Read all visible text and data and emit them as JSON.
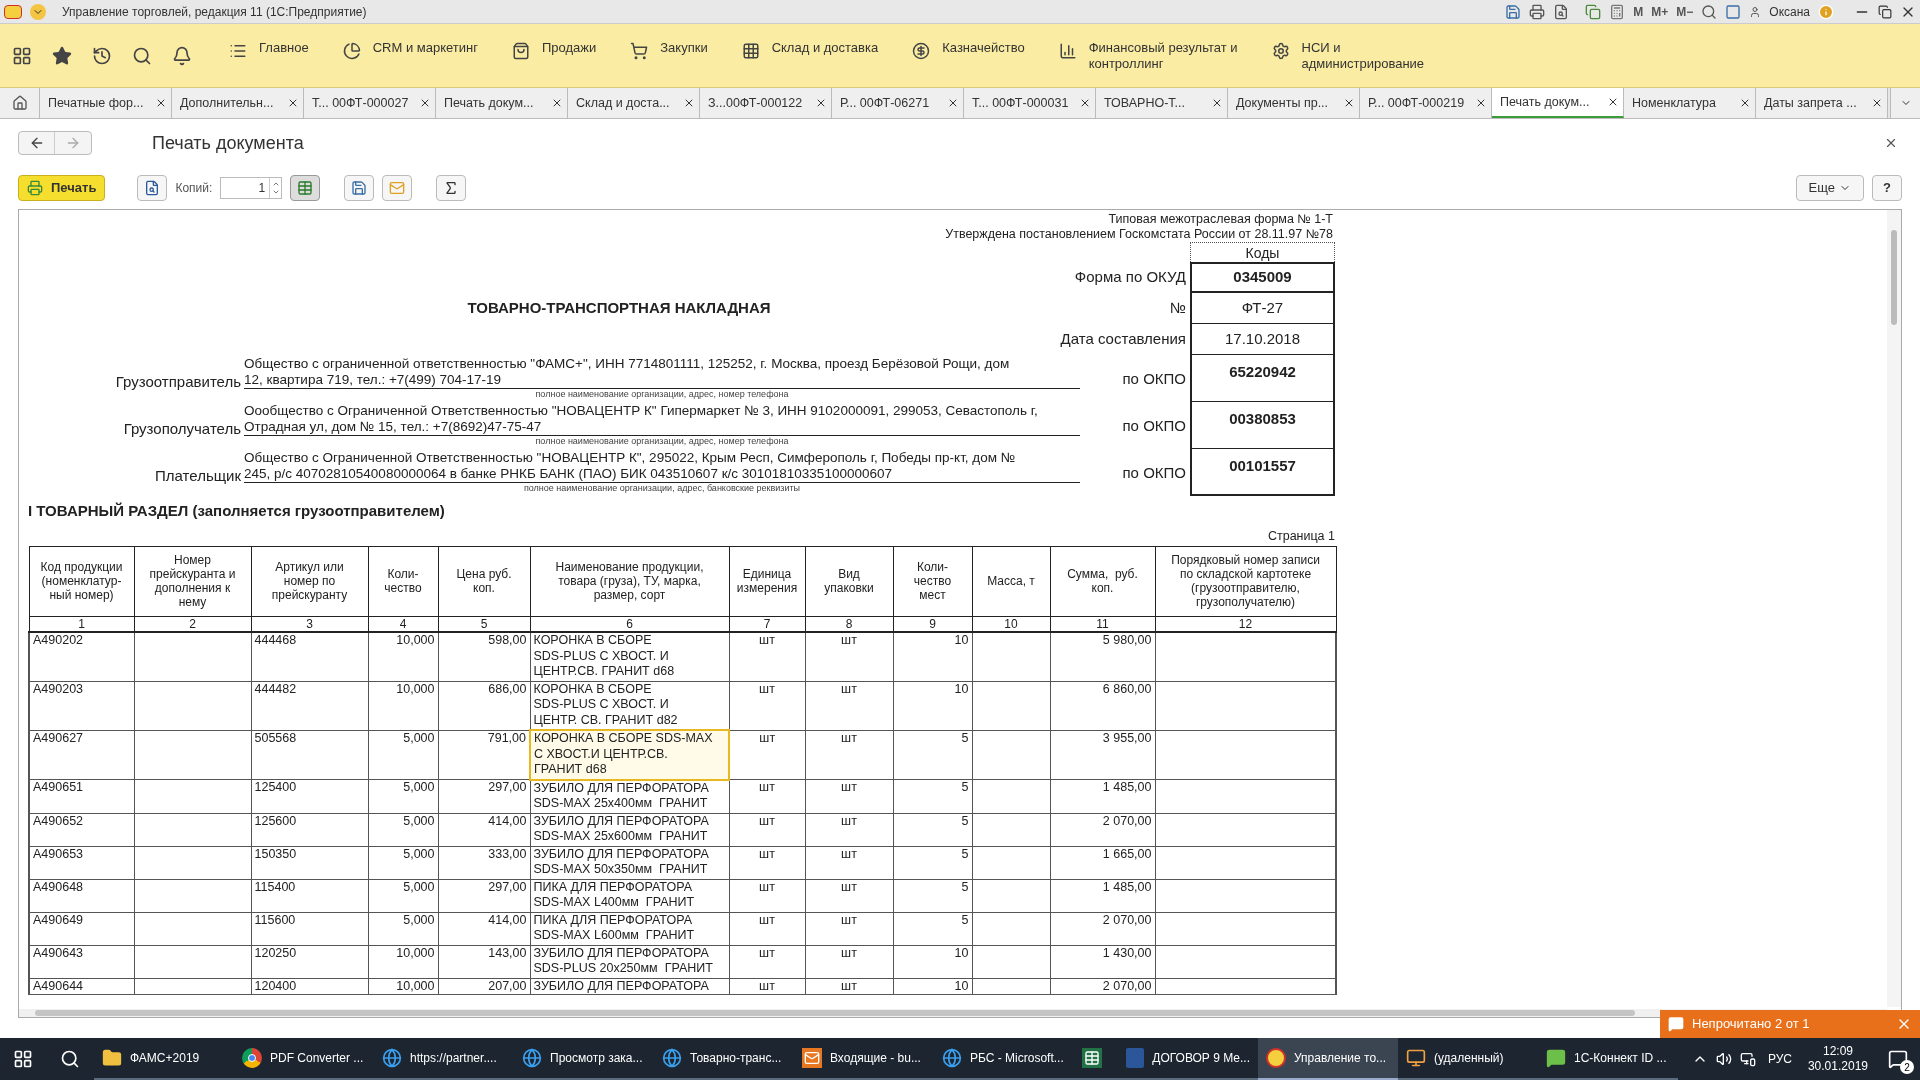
{
  "window": {
    "title": "Управление торговлей, редакция 11 (1С:Предприятие)",
    "memory_buttons": [
      "M",
      "M+",
      "M−"
    ],
    "user": "Оксана"
  },
  "menu": {
    "sections": [
      {
        "kind": "list",
        "label": "Главное"
      },
      {
        "kind": "pie",
        "label": "CRM и маркетинг"
      },
      {
        "kind": "bag",
        "label": "Продажи"
      },
      {
        "kind": "cart",
        "label": "Закупки"
      },
      {
        "kind": "grid",
        "label": "Склад и доставка"
      },
      {
        "kind": "coin",
        "label": "Казначейство"
      },
      {
        "kind": "chart",
        "label": "Финансовый результат и\nконтроллинг"
      },
      {
        "kind": "gear",
        "label": "НСИ и\nадминистрирование"
      }
    ]
  },
  "tabs": [
    {
      "label": "Печатные фор...",
      "selected": false
    },
    {
      "label": "Дополнительн...",
      "selected": false
    },
    {
      "label": "Т... 00ФТ-000027",
      "selected": false
    },
    {
      "label": "Печать докум...",
      "selected": false
    },
    {
      "label": "Склад и доста...",
      "selected": false
    },
    {
      "label": "З...00ФТ-000122",
      "selected": false
    },
    {
      "label": "Р... 00ФТ-06271",
      "selected": false
    },
    {
      "label": "Т... 00ФТ-000031",
      "selected": false
    },
    {
      "label": "ТОВАРНО-Т...",
      "selected": false
    },
    {
      "label": "Документы пр...",
      "selected": false
    },
    {
      "label": "Р... 00ФТ-000219",
      "selected": false
    },
    {
      "label": "Печать докум...",
      "selected": true
    },
    {
      "label": "Номенклатура",
      "selected": false
    },
    {
      "label": "Даты запрета ...",
      "selected": false
    }
  ],
  "form": {
    "title": "Печать документа",
    "print_button": "Печать",
    "copies_label": "Копий:",
    "copies_value": "1",
    "more_button": "Еще",
    "help_button": "?"
  },
  "document": {
    "form_note": [
      "Типовая межотраслевая форма № 1-Т",
      "Утверждена постановлением Госкомстата России от 28.11.97 №78"
    ],
    "codes_header": "Коды",
    "title": "ТОВАРНО-ТРАНСПОРТНАЯ НАКЛАДНАЯ",
    "codes": [
      {
        "label": "Форма по ОКУД",
        "value": "0345009",
        "bold": true
      },
      {
        "label": "№",
        "value": "ФТ-27",
        "bold": false
      },
      {
        "label": "Дата составления",
        "value": "17.10.2018",
        "bold": false
      }
    ],
    "parties": [
      {
        "label": "Грузоотправитель",
        "text": "Общество с ограниченной ответственностью \"ФАМС+\", ИНН 7714801111, 125252, г. Москва, проезд Берёзовой Рощи, дом\n12, квартира 719, тел.: +7(499) 704-17-19",
        "caption": "полное наименование организации, адрес, номер телефона",
        "code_label": "по ОКПО",
        "code": "65220942"
      },
      {
        "label": "Грузополучатель",
        "text": "Оообщество с Ограниченной Ответственностью \"НОВАЦЕНТР К\" Гипермаркет № 3, ИНН 9102000091, 299053, Севастополь г,\nОтрадная ул, дом № 15, тел.: +7(8692)47-75-47",
        "caption": "полное наименование организации, адрес, номер телефона",
        "code_label": "по ОКПО",
        "code": "00380853"
      },
      {
        "label": "Плательщик",
        "text": "Общество с Ограниченной Ответственностью \"НОВАЦЕНТР К\", 295022, Крым Респ, Симферополь г, Победы пр-кт, дом №\n245, р/с 40702810540080000064 в банке РНКБ БАНК (ПАО) БИК 043510607 к/с 30101810335100000607",
        "caption": "полное наименование организации, адрес, банковские реквизиты",
        "code_label": "по ОКПО",
        "code": "00101557"
      }
    ],
    "section_title": "I ТОВАРНЫЙ РАЗДЕЛ (заполняется грузоотправителем)",
    "page_label": "Страница 1",
    "table": {
      "columns": [
        {
          "label": "Код продукции\n(номенклатур-\nный номер)",
          "number": "1"
        },
        {
          "label": "Номер\nпрейскуранта и\nдополнения к\nнему",
          "number": "2"
        },
        {
          "label": "Артикул или\nномер по\nпрейскуранту",
          "number": "3"
        },
        {
          "label": "Коли-\nчество",
          "number": "4"
        },
        {
          "label": "Цена руб.\nкоп.",
          "number": "5"
        },
        {
          "label": "Наименование продукции,\nтовара (груза), ТУ, марка,\nразмер, сорт",
          "number": "6"
        },
        {
          "label": "Единица\nизмерения",
          "number": "7"
        },
        {
          "label": "Вид\nупаковки",
          "number": "8"
        },
        {
          "label": "Коли-\nчество\nмест",
          "number": "9"
        },
        {
          "label": "Масса, т",
          "number": "10"
        },
        {
          "label": "Сумма,  руб.\nкоп.",
          "number": "11"
        },
        {
          "label": "Порядковый номер записи\nпо складской картотеке\n(грузоотправителю,\nгрузополучателю)",
          "number": "12"
        }
      ],
      "rows": [
        {
          "selected": false,
          "cells": [
            "A490202",
            "",
            "444468",
            "10,000",
            "598,00",
            "КОРОНКА В СБОРЕ\nSDS-PLUS С ХВОСТ. И\nЦЕНТР.СВ. ГРАНИТ d68",
            "шт",
            "шт",
            "10",
            "",
            "5 980,00",
            ""
          ]
        },
        {
          "selected": false,
          "cells": [
            "A490203",
            "",
            "444482",
            "10,000",
            "686,00",
            "КОРОНКА В СБОРЕ\nSDS-PLUS С ХВОСТ. И\nЦЕНТР. СВ. ГРАНИТ d82",
            "шт",
            "шт",
            "10",
            "",
            "6 860,00",
            ""
          ]
        },
        {
          "selected": true,
          "cells": [
            "A490627",
            "",
            "505568",
            "5,000",
            "791,00",
            "КОРОНКА В СБОРЕ SDS-MAX\nС ХВОСТ.И ЦЕНТР.СВ.\nГРАНИТ d68",
            "шт",
            "шт",
            "5",
            "",
            "3 955,00",
            ""
          ]
        },
        {
          "selected": false,
          "cells": [
            "A490651",
            "",
            "125400",
            "5,000",
            "297,00",
            "ЗУБИЛО ДЛЯ ПЕРФОРАТОРА\nSDS-MAX 25x400мм  ГРАНИТ",
            "шт",
            "шт",
            "5",
            "",
            "1 485,00",
            ""
          ]
        },
        {
          "selected": false,
          "cells": [
            "A490652",
            "",
            "125600",
            "5,000",
            "414,00",
            "ЗУБИЛО ДЛЯ ПЕРФОРАТОРА\nSDS-MAX 25x600мм  ГРАНИТ",
            "шт",
            "шт",
            "5",
            "",
            "2 070,00",
            ""
          ]
        },
        {
          "selected": false,
          "cells": [
            "A490653",
            "",
            "150350",
            "5,000",
            "333,00",
            "ЗУБИЛО ДЛЯ ПЕРФОРАТОРА\nSDS-MAX 50x350мм  ГРАНИТ",
            "шт",
            "шт",
            "5",
            "",
            "1 665,00",
            ""
          ]
        },
        {
          "selected": false,
          "cells": [
            "A490648",
            "",
            "115400",
            "5,000",
            "297,00",
            "ПИКА ДЛЯ ПЕРФОРАТОРА\nSDS-MAX L400мм  ГРАНИТ",
            "шт",
            "шт",
            "5",
            "",
            "1 485,00",
            ""
          ]
        },
        {
          "selected": false,
          "cells": [
            "A490649",
            "",
            "115600",
            "5,000",
            "414,00",
            "ПИКА ДЛЯ ПЕРФОРАТОРА\nSDS-MAX L600мм  ГРАНИТ",
            "шт",
            "шт",
            "5",
            "",
            "2 070,00",
            ""
          ]
        },
        {
          "selected": false,
          "cells": [
            "A490643",
            "",
            "120250",
            "10,000",
            "143,00",
            "ЗУБИЛО ДЛЯ ПЕРФОРАТОРА\nSDS-PLUS 20x250мм  ГРАНИТ",
            "шт",
            "шт",
            "10",
            "",
            "1 430,00",
            ""
          ]
        },
        {
          "selected": false,
          "cells": [
            "A490644",
            "",
            "120400",
            "10,000",
            "207,00",
            "ЗУБИЛО ДЛЯ ПЕРФОРАТОРА",
            "шт",
            "шт",
            "10",
            "",
            "2 070,00",
            ""
          ]
        }
      ]
    }
  },
  "notification": {
    "text": "Непрочитано 2 от 1"
  },
  "taskbar": {
    "items": [
      {
        "kind": "folder",
        "label": "ФАМС+2019",
        "selected": false
      },
      {
        "kind": "chrome",
        "label": "PDF Converter ...",
        "selected": false
      },
      {
        "kind": "edge",
        "label": "https://partner....",
        "selected": false
      },
      {
        "kind": "edge",
        "label": "Просмотр зака...",
        "selected": false
      },
      {
        "kind": "edge",
        "label": "Товарно-транс...",
        "selected": false
      },
      {
        "kind": "outlook",
        "label": "Входящие - bu...",
        "selected": false
      },
      {
        "kind": "edge",
        "label": "РБС - Microsoft...",
        "selected": false
      },
      {
        "kind": "excel",
        "selected": false
      },
      {
        "kind": "word",
        "label": "ДОГОВОР 9 Ме...",
        "selected": false
      },
      {
        "kind": "onec",
        "label": "Управление то...",
        "selected": true
      },
      {
        "kind": "remote",
        "label": "(удаленный)",
        "selected": false
      },
      {
        "kind": "connect",
        "label": "1С-Коннект ID ...",
        "selected": false
      }
    ],
    "language": "РУС",
    "time": "12:09",
    "date": "30.01.2019",
    "notifications_count": "2"
  }
}
